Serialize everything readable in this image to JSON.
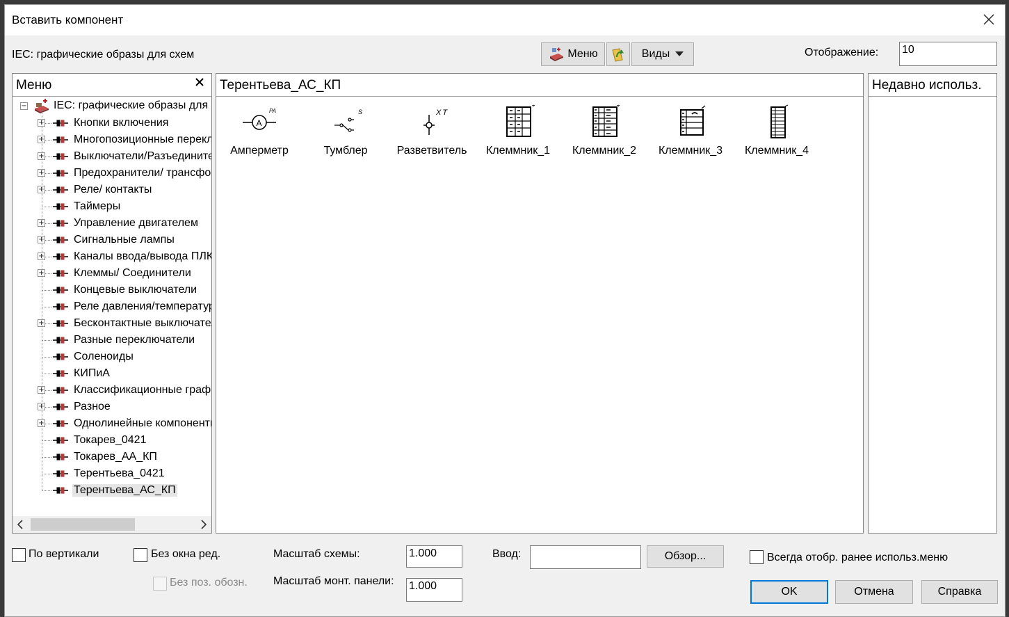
{
  "dialog": {
    "title": "Вставить компонент"
  },
  "top": {
    "library_label": "IEC: графические образы для схем",
    "menu_button": "Меню",
    "views_button": "Виды",
    "display_label": "Отображение:",
    "display_value": "10"
  },
  "menu_panel": {
    "header": "Меню",
    "root": "IEC: графические образы для схем",
    "items": [
      {
        "label": "Кнопки включения",
        "expandable": true
      },
      {
        "label": "Многопозиционные переключатели",
        "expandable": true
      },
      {
        "label": "Выключатели/Разъединители",
        "expandable": true
      },
      {
        "label": "Предохранители/ трансформаторы",
        "expandable": true
      },
      {
        "label": "Реле/ контакты",
        "expandable": true
      },
      {
        "label": "Таймеры",
        "expandable": false
      },
      {
        "label": "Управление двигателем",
        "expandable": true
      },
      {
        "label": "Сигнальные лампы",
        "expandable": true
      },
      {
        "label": "Каналы ввода/вывода ПЛК",
        "expandable": true
      },
      {
        "label": "Клеммы/ Соединители",
        "expandable": true
      },
      {
        "label": "Концевые выключатели",
        "expandable": false
      },
      {
        "label": "Реле давления/температуры",
        "expandable": false
      },
      {
        "label": "Бесконтактные выключатели",
        "expandable": true
      },
      {
        "label": "Разные переключатели",
        "expandable": false
      },
      {
        "label": "Соленоиды",
        "expandable": false
      },
      {
        "label": "КИПиА",
        "expandable": false
      },
      {
        "label": "Классификационные графические",
        "expandable": true
      },
      {
        "label": "Разное",
        "expandable": true
      },
      {
        "label": "Однолинейные компоненты",
        "expandable": true
      },
      {
        "label": "Токарев_0421",
        "expandable": false
      },
      {
        "label": "Токарев_АА_КП",
        "expandable": false
      },
      {
        "label": "Терентьева_0421",
        "expandable": false
      },
      {
        "label": "Терентьева_АС_КП",
        "expandable": false,
        "selected": true
      }
    ]
  },
  "content_panel": {
    "header": "Терентьева_АС_КП",
    "items": [
      {
        "label": "Амперметр",
        "icon": "ammeter-icon",
        "tag": "PA"
      },
      {
        "label": "Тумблер",
        "icon": "toggle-switch-icon",
        "tag": "S"
      },
      {
        "label": "Разветвитель",
        "icon": "splitter-icon",
        "tag": "XT"
      },
      {
        "label": "Клеммник_1",
        "icon": "terminal-block-icon"
      },
      {
        "label": "Клеммник_2",
        "icon": "terminal-block-icon"
      },
      {
        "label": "Клеммник_3",
        "icon": "terminal-block-icon"
      },
      {
        "label": "Клеммник_4",
        "icon": "terminal-block-icon"
      }
    ]
  },
  "recent_panel": {
    "header": "Недавно использ."
  },
  "bottom": {
    "vertical_label": "По вертикали",
    "no_edit_window_label": "Без окна ред.",
    "no_pos_label": "Без поз. обозн.",
    "scheme_scale_label": "Масштаб схемы:",
    "scheme_scale_value": "1.000",
    "panel_scale_label": "Масштаб монт. панели:",
    "panel_scale_value": "1.000",
    "input_label": "Ввод:",
    "input_value": "",
    "browse_button": "Обзор...",
    "always_show_label": "Всегда отобр. ранее использ.меню",
    "ok_button": "OK",
    "cancel_button": "Отмена",
    "help_button": "Справка"
  }
}
